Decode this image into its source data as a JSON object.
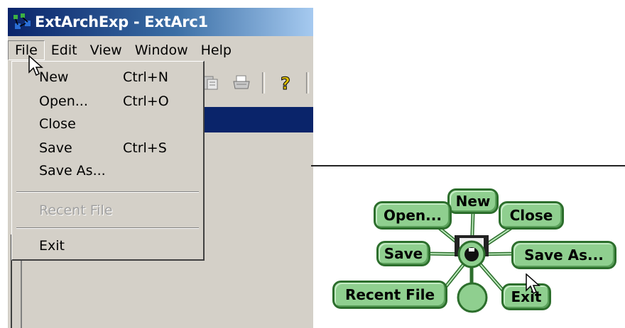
{
  "window": {
    "title": "ExtArchExp - ExtArc1"
  },
  "menubar": {
    "items": [
      {
        "label": "File"
      },
      {
        "label": "Edit"
      },
      {
        "label": "View"
      },
      {
        "label": "Window"
      },
      {
        "label": "Help"
      }
    ]
  },
  "file_menu": {
    "items": [
      {
        "label": "New",
        "shortcut": "Ctrl+N",
        "enabled": true
      },
      {
        "label": "Open...",
        "shortcut": "Ctrl+O",
        "enabled": true
      },
      {
        "label": "Close",
        "shortcut": "",
        "enabled": true
      },
      {
        "label": "Save",
        "shortcut": "Ctrl+S",
        "enabled": true
      },
      {
        "label": "Save As...",
        "shortcut": "",
        "enabled": true
      },
      {
        "label": "Recent File",
        "shortcut": "",
        "enabled": false
      },
      {
        "label": "Exit",
        "shortcut": "",
        "enabled": true
      }
    ]
  },
  "toolbar": {
    "icons": [
      "document-icon",
      "printer-icon",
      "help-icon"
    ]
  },
  "pie_menu": {
    "items": {
      "new": "New",
      "open": "Open...",
      "close": "Close",
      "save": "Save",
      "save_as": "Save As...",
      "recent_file": "Recent File",
      "exit": "Exit"
    }
  },
  "colors": {
    "titlebar": "#0a246a",
    "menu_bg": "#d4d0c8",
    "pie_fill": "#8fcf8f",
    "pie_border": "#2c6e2c"
  }
}
